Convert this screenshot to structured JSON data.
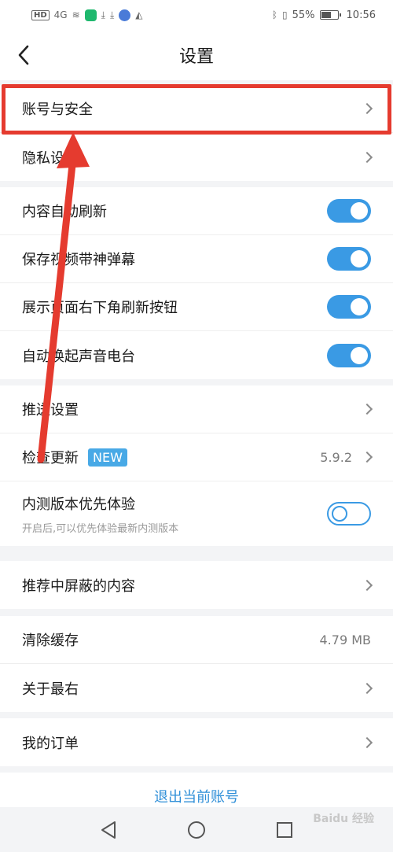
{
  "status_bar": {
    "network": "HD",
    "signal": "4G",
    "battery": "55%",
    "time": "10:56"
  },
  "nav": {
    "title": "设置"
  },
  "group1": [
    {
      "label": "账号与安全"
    },
    {
      "label": "隐私设置"
    }
  ],
  "group2": [
    {
      "label": "内容自动刷新",
      "toggle": true
    },
    {
      "label": "保存视频带神弹幕",
      "toggle": true
    },
    {
      "label": "展示页面右下角刷新按钮",
      "toggle": true
    },
    {
      "label": "自动唤起声音电台",
      "toggle": true
    }
  ],
  "group3": {
    "push": {
      "label": "推送设置"
    },
    "update": {
      "label": "检查更新",
      "badge": "NEW",
      "version": "5.9.2"
    },
    "beta": {
      "label": "内测版本优先体验",
      "sub": "开启后,可以优先体验最新内测版本",
      "toggle": false
    }
  },
  "group4": [
    {
      "label": "推荐中屏蔽的内容"
    }
  ],
  "group5": {
    "cache": {
      "label": "清除缓存",
      "value": "4.79 MB"
    },
    "about": {
      "label": "关于最右"
    }
  },
  "group6": [
    {
      "label": "我的订单"
    }
  ],
  "logout": {
    "label": "退出当前账号"
  },
  "watermark": "Baidu 经验",
  "colors": {
    "accent": "#3a9ae4",
    "highlight": "#e53b2f",
    "logout": "#2f8fd8"
  }
}
